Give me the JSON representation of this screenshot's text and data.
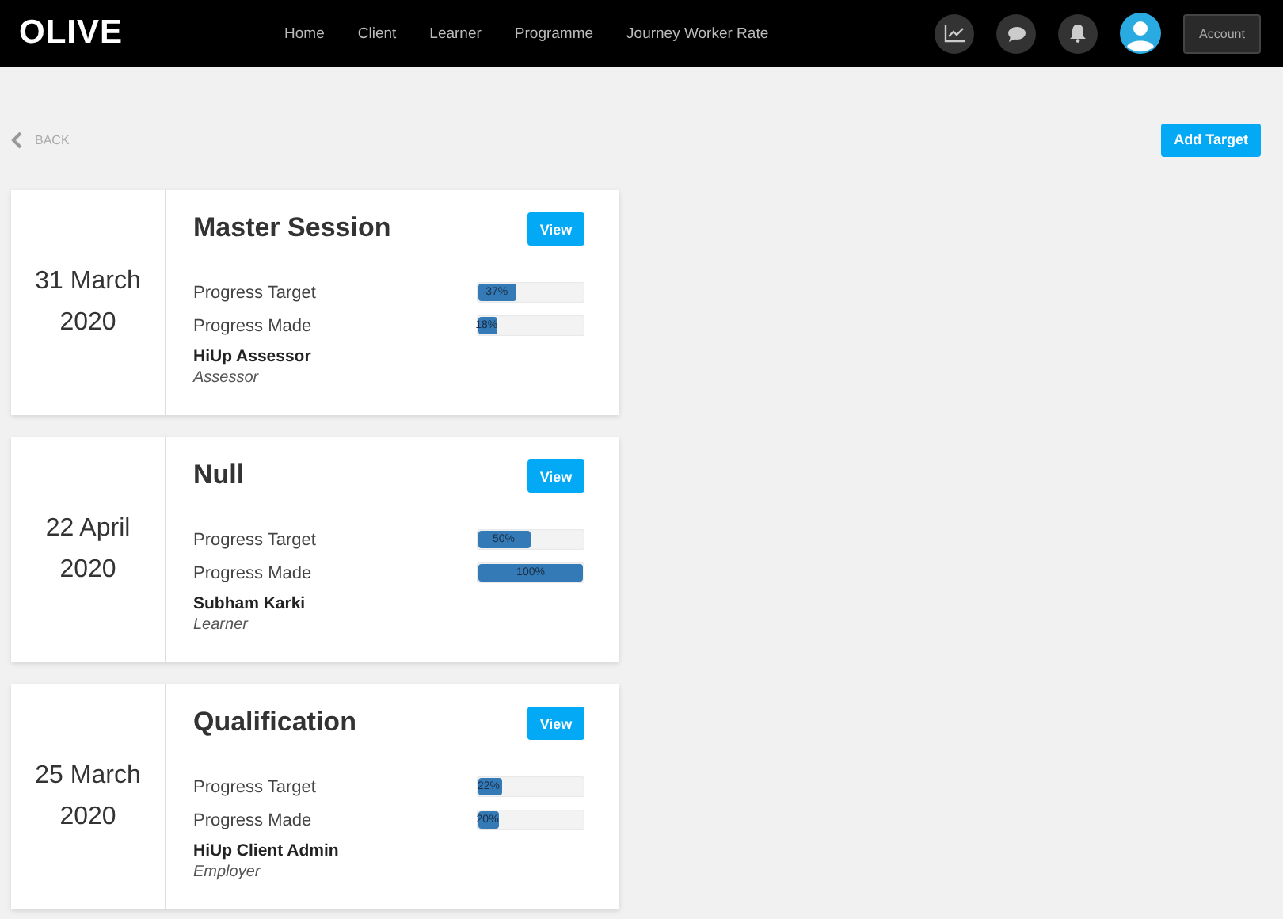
{
  "header": {
    "logo": "OLIVE",
    "nav": [
      {
        "label": "Home"
      },
      {
        "label": "Client"
      },
      {
        "label": "Learner"
      },
      {
        "label": "Programme"
      },
      {
        "label": "Journey Worker Rate"
      }
    ],
    "account_button": "Account"
  },
  "back_link": "BACK",
  "add_button": "Add Target",
  "targets": [
    {
      "date_day": "31 March",
      "date_year": "2020",
      "title": "Master Session",
      "view_button": "View",
      "progress": [
        {
          "label": "Progress Target",
          "level": 0.37,
          "reading": "37%"
        },
        {
          "label": "Progress Made",
          "level": 0.18,
          "reading": "18%"
        }
      ],
      "person": "HiUp Assessor",
      "role": "Assessor"
    },
    {
      "date_day": "22 April",
      "date_year": "2020",
      "title": "Null",
      "view_button": "View",
      "progress": [
        {
          "label": "Progress Target",
          "level": 0.5,
          "reading": "50%"
        },
        {
          "label": "Progress Made",
          "level": 1,
          "reading": "100%"
        }
      ],
      "person": "Subham Karki",
      "role": "Learner"
    },
    {
      "date_day": "25 March",
      "date_year": "2020",
      "title": "Qualification",
      "view_button": "View",
      "progress": [
        {
          "label": "Progress Target",
          "level": 0.22,
          "reading": "22%"
        },
        {
          "label": "Progress Made",
          "level": 0.2,
          "reading": "20%"
        }
      ],
      "person": "HiUp Client Admin",
      "role": "Employer"
    }
  ]
}
